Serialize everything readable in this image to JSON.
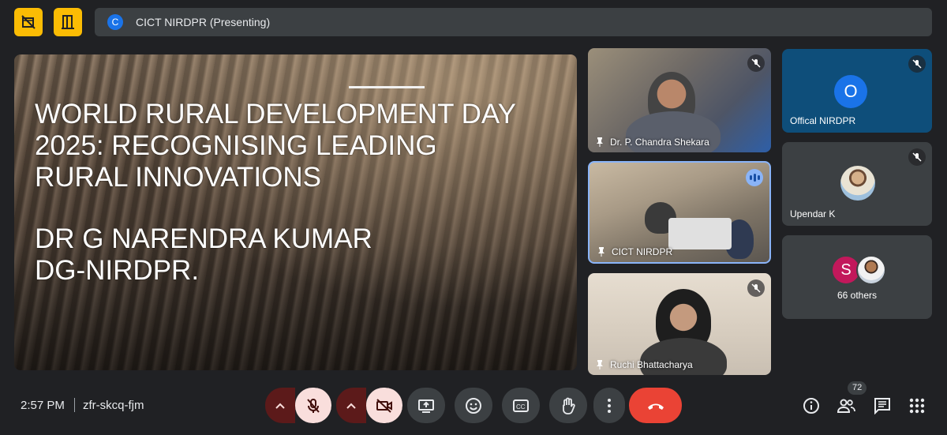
{
  "meeting": {
    "presenter_banner": "CICT NIRDPR (Presenting)",
    "banner_avatar_letter": "C",
    "time": "2:57 PM",
    "code": "zfr-skcq-fjm"
  },
  "slide": {
    "title": "WORLD RURAL DEVELOPMENT DAY\n2025:  RECOGNISING LEADING\nRURAL INNOVATIONS",
    "author": "DR G NARENDRA KUMAR\nDG-NIRDPR."
  },
  "tiles": [
    {
      "name": "Dr. P. Chandra Shekara",
      "muted": true
    },
    {
      "name": "CICT NIRDPR",
      "speaking": true
    },
    {
      "name": "Ruchi Bhattacharya",
      "muted": true
    }
  ],
  "side": {
    "offical": {
      "name": "Offical NIRDPR",
      "letter": "O"
    },
    "upendar": {
      "name": "Upendar K"
    },
    "others": {
      "letter": "S",
      "label": "66 others"
    }
  },
  "participants_count": "72",
  "colors": {
    "accent_yellow": "#fbbc04",
    "end_call": "#ea4335",
    "active_border": "#8ab4f8",
    "avatar_blue": "#1a73e8",
    "avatar_pink": "#c2185b"
  },
  "icons": [
    "no-video-icon",
    "door-icon",
    "chevron-up-icon",
    "mic-off-icon",
    "video-off-icon",
    "present-icon",
    "emoji-icon",
    "captions-icon",
    "hand-icon",
    "more-vert-icon",
    "end-call-icon",
    "info-icon",
    "people-icon",
    "chat-icon",
    "apps-icon",
    "pin-icon",
    "speaking-icon"
  ]
}
